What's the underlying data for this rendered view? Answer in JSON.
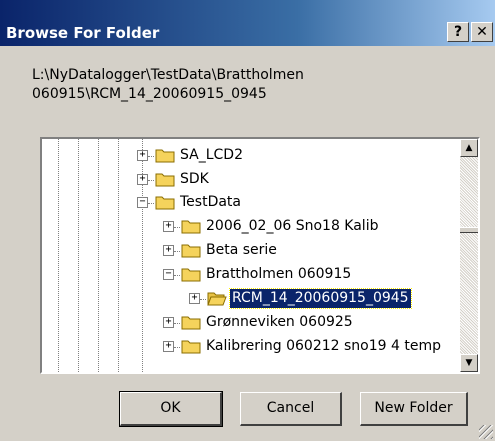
{
  "window": {
    "title": "Browse For Folder",
    "help_button": "?",
    "close_button": "✕"
  },
  "selected_path": "L:\\NyDatalogger\\TestData\\Brattholmen 060915\\RCM_14_20060915_0945",
  "tree": {
    "items": [
      {
        "label": "SA_LCD2",
        "expander": "+",
        "selected": false
      },
      {
        "label": "SDK",
        "expander": "+",
        "selected": false
      },
      {
        "label": "TestData",
        "expander": "−",
        "selected": false
      },
      {
        "label": "2006_02_06 Sno18 Kalib",
        "expander": "+",
        "selected": false
      },
      {
        "label": "Beta serie",
        "expander": "+",
        "selected": false
      },
      {
        "label": "Brattholmen 060915",
        "expander": "−",
        "selected": false
      },
      {
        "label": "RCM_14_20060915_0945",
        "expander": "+",
        "selected": true
      },
      {
        "label": "Grønneviken 060925",
        "expander": "+",
        "selected": false
      },
      {
        "label": "Kalibrering 060212 sno19 4 temp",
        "expander": "+",
        "selected": false
      }
    ]
  },
  "buttons": {
    "ok": "OK",
    "cancel": "Cancel",
    "new_folder": "New Folder"
  },
  "colors": {
    "selection": "#0a246a",
    "folder": "#f5d35c",
    "dialog_face": "#d4d0c8"
  }
}
